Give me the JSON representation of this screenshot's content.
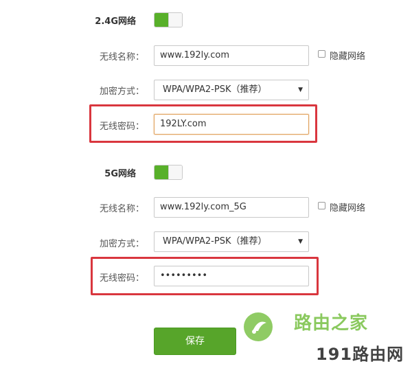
{
  "band_24g": {
    "title": "2.4G网络",
    "toggle_on": true,
    "ssid_label": "无线名称：",
    "ssid_value": "www.192ly.com",
    "hide_label": "隐藏网络",
    "hide_checked": false,
    "encrypt_label": "加密方式：",
    "encrypt_value": "WPA/WPA2-PSK（推荐）",
    "password_label": "无线密码：",
    "password_value": "192LY.com"
  },
  "band_5g": {
    "title": "5G网络",
    "toggle_on": true,
    "ssid_label": "无线名称：",
    "ssid_value": "www.192ly.com_5G",
    "hide_label": "隐藏网络",
    "hide_checked": false,
    "encrypt_label": "加密方式：",
    "encrypt_value": "WPA/WPA2-PSK（推荐）",
    "password_label": "无线密码：",
    "password_value": "•••••••••"
  },
  "actions": {
    "save_label": "保存"
  },
  "watermark": {
    "brand_a": "路由之家",
    "brand_b": "191路由网"
  },
  "colors": {
    "accent_green": "#57a52a",
    "highlight_red": "#d9363e",
    "focus_orange": "#e0a05a"
  },
  "icons": {
    "select_arrow": "▼"
  }
}
